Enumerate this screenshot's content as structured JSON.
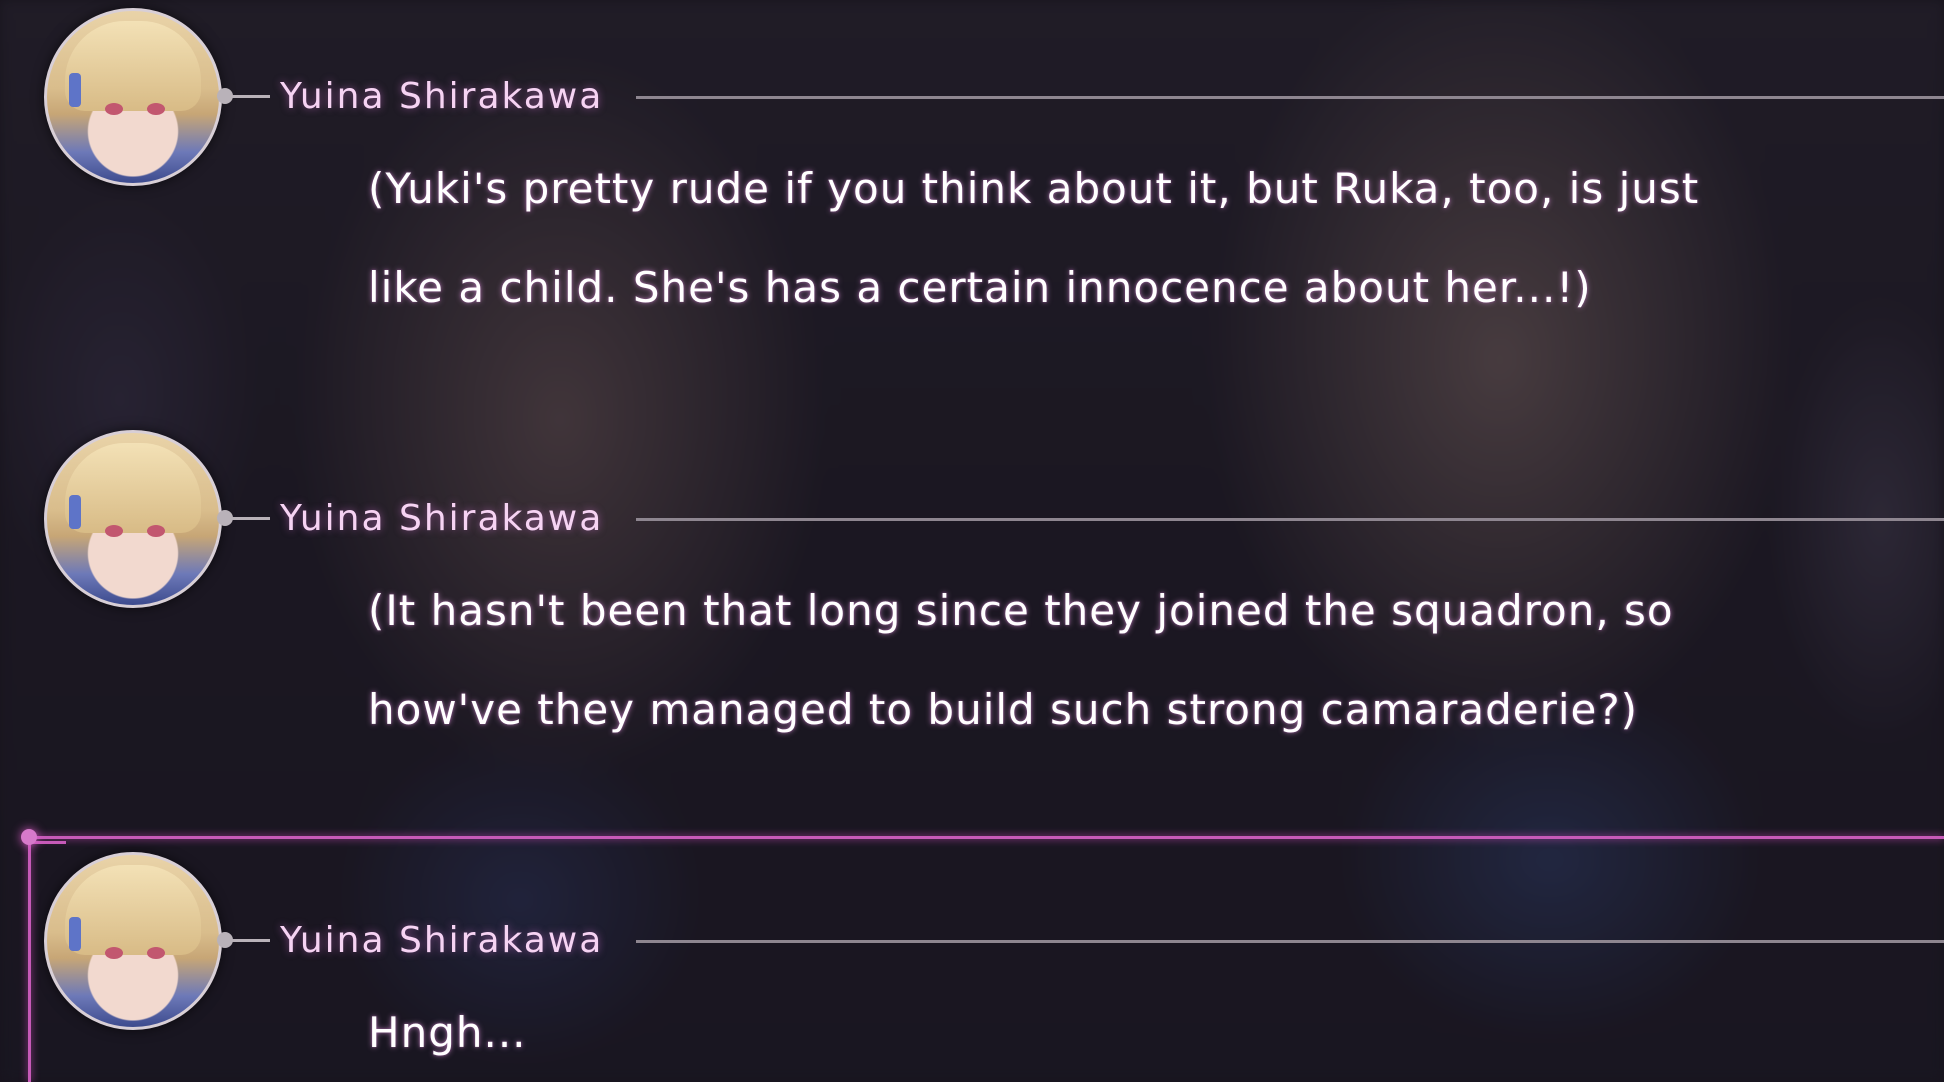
{
  "log_entries": [
    {
      "speaker": "Yuina Shirakawa",
      "lines": [
        "(Yuki's pretty rude if you think about it, but Ruka, too, is just",
        "like a child. She's has a certain innocence about her...!)"
      ]
    },
    {
      "speaker": "Yuina Shirakawa",
      "lines": [
        "(It hasn't been that long since they joined the squadron, so",
        "how've they managed to build such strong camaraderie?)"
      ]
    },
    {
      "speaker": "Yuina Shirakawa",
      "lines": [
        "Hngh..."
      ]
    }
  ],
  "colors": {
    "speaker_name": "#f6d3f3",
    "current_marker": "#c65ab8",
    "dialogue_text": "#ffffff"
  }
}
